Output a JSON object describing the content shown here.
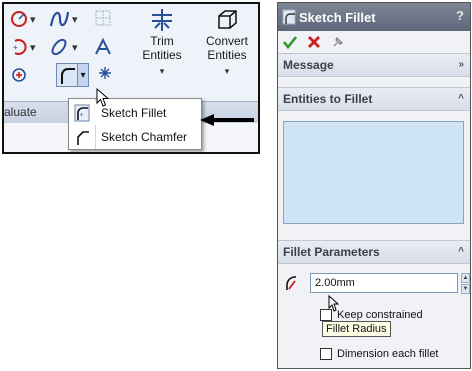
{
  "ribbon": {
    "trim": {
      "line1": "Trim",
      "line2": "Entities",
      "icon": "trim-entities-icon"
    },
    "convert": {
      "line1": "Convert",
      "line2": "Entities",
      "icon": "convert-entities-icon"
    },
    "tab_partial": "aluate",
    "dropdown_glyph": "▾"
  },
  "fillet_menu": {
    "items": [
      {
        "label": "Sketch Fillet",
        "icon": "sketch-fillet-icon"
      },
      {
        "label": "Sketch Chamfer",
        "icon": "sketch-chamfer-icon"
      }
    ]
  },
  "property_manager": {
    "title": "Sketch Fillet",
    "help_glyph": "?",
    "actions": [
      {
        "name": "ok",
        "icon": "check-icon",
        "color": "#2e9a2e"
      },
      {
        "name": "cancel",
        "icon": "x-icon",
        "color": "#c8201c"
      },
      {
        "name": "detailed-preview",
        "icon": "pushpin-icon",
        "color": "#777777"
      }
    ],
    "groups": {
      "message": {
        "title": "Message",
        "chevron": "»"
      },
      "entities": {
        "title": "Entities to Fillet",
        "chevron": "^"
      },
      "params": {
        "title": "Fillet Parameters",
        "chevron": "^"
      }
    },
    "radius_value": "2.00mm",
    "keep_constrained_label": "Keep constrained",
    "tooltip": "Fillet Radius",
    "dimension_each_label": "Dimension each fillet",
    "colors": {
      "title_bar": "#6b7588",
      "list_box": "#cfe5f5",
      "radius_icon": "#c8201c"
    }
  }
}
